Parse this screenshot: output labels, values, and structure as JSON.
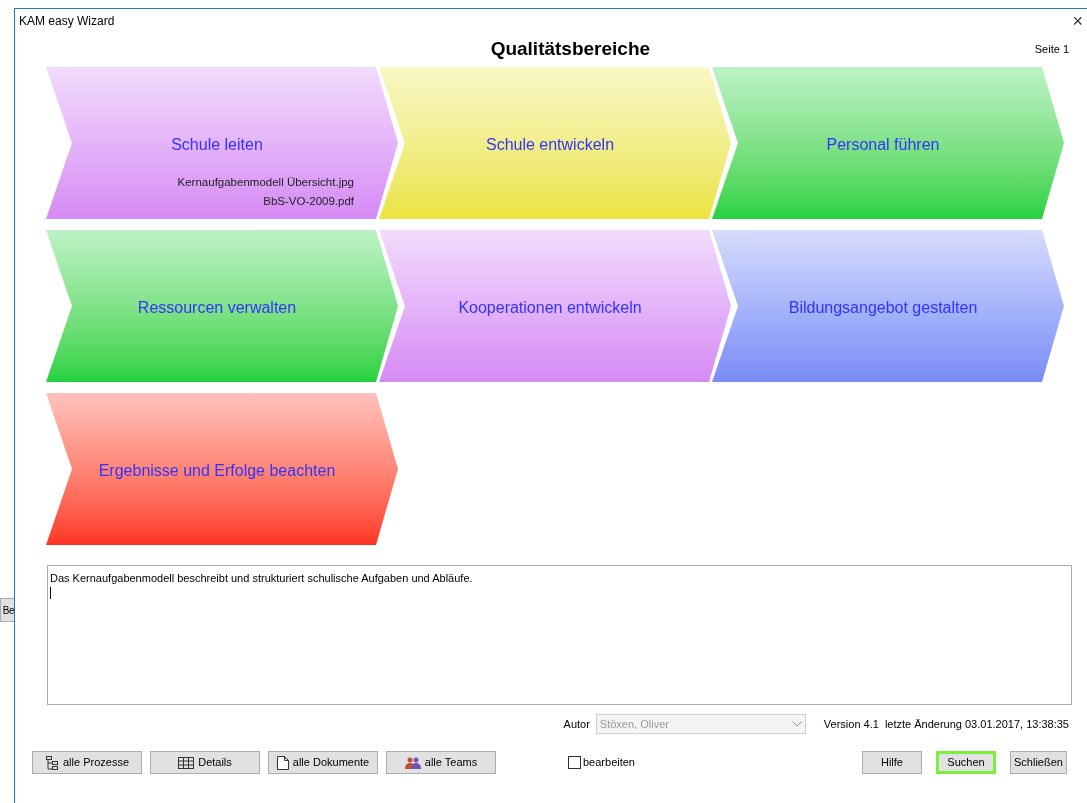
{
  "background_window": {
    "button_label": "Be"
  },
  "window": {
    "title": "KAM easy Wizard",
    "close": "×"
  },
  "heading": "Qualitätsbereiche",
  "page": "Seite 1",
  "areas": [
    {
      "title": "Schule leiten",
      "color": "#d58af4",
      "files": [
        "Kernaufgabenmodell Übersicht.jpg",
        "BbS-VO-2009.pdf"
      ]
    },
    {
      "title": "Schule entwickeln",
      "color": "#ebe43c"
    },
    {
      "title": "Personal führen",
      "color": "#22d23e"
    },
    {
      "title": "Ressourcen verwalten",
      "color": "#22d23e"
    },
    {
      "title": "Kooperationen entwickeln",
      "color": "#d58af4"
    },
    {
      "title": "Bildungsangebot gestalten",
      "color": "#7b8cf6"
    },
    {
      "title": "Ergebnisse und Erfolge beachten",
      "color": "#ff3222"
    }
  ],
  "description": "Das Kernaufgabenmodell beschreibt und strukturiert schulische Aufgaben und Abläufe.",
  "author": {
    "label": "Autor",
    "value": "Stöxen, Oliver",
    "disabled": true
  },
  "version": "Version 4.1",
  "last_change": "letzte Änderung 03.01.2017, 13:38:35",
  "left_buttons": [
    {
      "label": "alle Prozesse",
      "kind": "tree"
    },
    {
      "label": "Details",
      "kind": "table"
    },
    {
      "label": "alle Dokumente",
      "kind": "document"
    },
    {
      "label": "alle Teams",
      "kind": "people"
    }
  ],
  "edit_checkbox": {
    "label": "bearbeiten",
    "checked": false
  },
  "right_buttons": [
    {
      "label": "Hilfe",
      "focused": false
    },
    {
      "label": "Suchen",
      "focused": true
    },
    {
      "label": "Schließen",
      "focused": false
    }
  ]
}
